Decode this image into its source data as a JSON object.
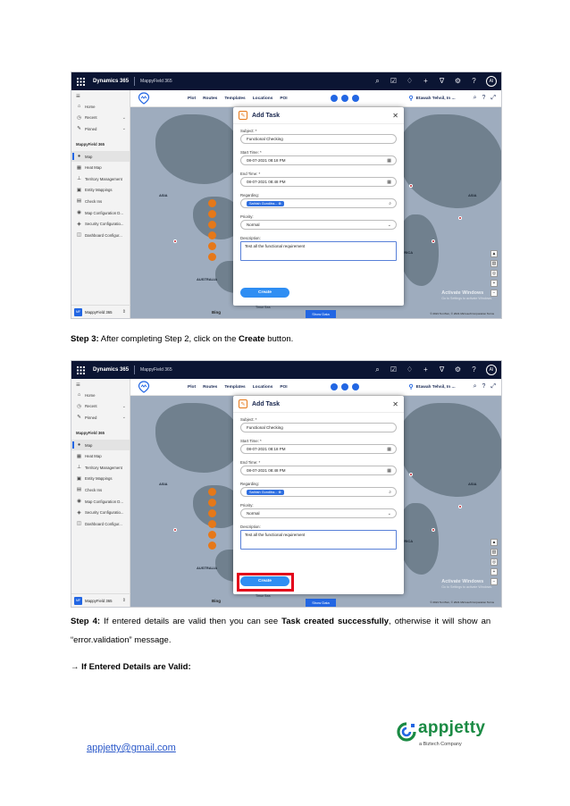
{
  "dynamics": {
    "brand": "Dynamics 365",
    "app": "MappyField 365",
    "avatar": "AI"
  },
  "sidebar": {
    "items_top": [
      {
        "label": "Home",
        "icon": "home-icon"
      },
      {
        "label": "Recent",
        "icon": "clock-icon",
        "chevron": true
      },
      {
        "label": "Pinned",
        "icon": "pin-icon",
        "chevron": true
      }
    ],
    "group": "MappyField 365",
    "items": [
      {
        "label": "Map",
        "icon": "map-pin-icon",
        "active": true
      },
      {
        "label": "Heat Map",
        "icon": "heat-map-icon"
      },
      {
        "label": "Territory Management",
        "icon": "territory-icon"
      },
      {
        "label": "Entity Mappings",
        "icon": "entity-icon"
      },
      {
        "label": "Check Ins",
        "icon": "check-in-icon"
      },
      {
        "label": "Map Configuration D...",
        "icon": "map-config-icon"
      },
      {
        "label": "Security Configuratio...",
        "icon": "security-icon"
      },
      {
        "label": "Dashboard Configur...",
        "icon": "dashboard-icon"
      }
    ],
    "footer": "MappyField 365",
    "footer_badge": "MF"
  },
  "map_nav": {
    "tabs": [
      "Plot",
      "Routes",
      "Templates",
      "Locations",
      "POI"
    ],
    "location": "Etawah Tehsil, In ..."
  },
  "map": {
    "labels": [
      "ASIA",
      "AUSTRALIA",
      "ASIA",
      "AFRICA"
    ],
    "show_data": "Show Data",
    "activate": "Activate Windows",
    "activate_sub": "Go to Settings to activate Windows.",
    "bing": "Bing",
    "attribution": "© 2021 TomTom, © 2021 Microsoft Corporation  Terms",
    "timezone": "Timor Sea"
  },
  "modal": {
    "title": "Add Task",
    "subject_label": "Subject: *",
    "subject_value": "Functional Checking",
    "start_label": "Start Time: *",
    "start_value": "08-07-2021 08:18 PM",
    "end_label": "End Time: *",
    "end_value": "08-07-2021 08:48 PM",
    "regarding_label": "Regarding:",
    "regarding_tag": "Sathish Gunditra...",
    "priority_label": "Priority:",
    "priority_value": "Normal",
    "description_label": "Description:",
    "description_value": "Test all the functional requirement",
    "create": "Create"
  },
  "doc": {
    "step3_lead": "Step 3:",
    "step3_a": " After completing Step 2, click on the ",
    "step3_b": "Create",
    "step3_c": " button.",
    "step4_lead": "Step 4:",
    "step4_a": " If entered details are valid then you can see ",
    "step4_b": "Task created successfully",
    "step4_c": ", otherwise it will show an",
    "step4_d": "“error.validation” message.",
    "step5": "→ If Entered Details are Valid:",
    "email": "appjetty@gmail.com",
    "logo_word": "appjetty",
    "logo_sub": "a Biztech Company"
  },
  "colors": {
    "topbar": "#0b1533",
    "accent": "#2266e3",
    "highlight": "#e3001b",
    "logo_green": "#1a8a43"
  }
}
